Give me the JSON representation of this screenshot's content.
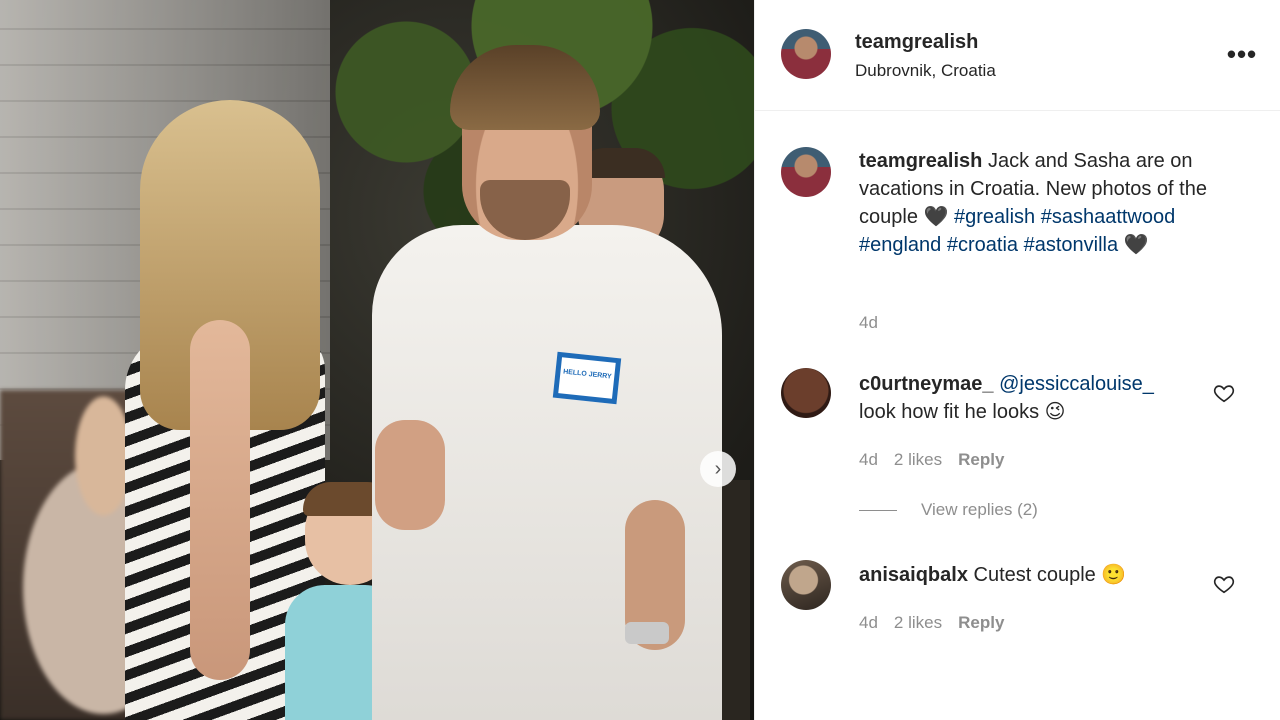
{
  "post": {
    "username": "teamgrealish",
    "location": "Dubrovnik, Croatia",
    "more_glyph": "•••",
    "next_glyph": "›"
  },
  "caption": {
    "username": "teamgrealish",
    "text": "Jack and Sasha are on vacations in Croatia. New photos of the couple",
    "heart_glyph": "🖤",
    "tags": [
      "#grealish",
      "#sashaattwood",
      "#england",
      "#croatia",
      "#astonvilla"
    ],
    "end_glyph": "🖤",
    "age": "4d"
  },
  "photo": {
    "name_tag_text": "HELLO JERRY"
  },
  "comments": [
    {
      "username": "c0urtneymae_",
      "mention": "@jessiccalouise_",
      "text": "look how fit he looks 😉",
      "age": "4d",
      "likes": "2 likes",
      "reply": "Reply",
      "view_replies": "View replies (2)"
    },
    {
      "username": "anisaiqbalx",
      "text": "Cutest couple 🙂",
      "age": "4d",
      "likes": "2 likes",
      "reply": "Reply"
    }
  ],
  "icons": {
    "heart": "heart-outline-icon",
    "more": "more-options-icon",
    "next": "chevron-right-icon"
  }
}
